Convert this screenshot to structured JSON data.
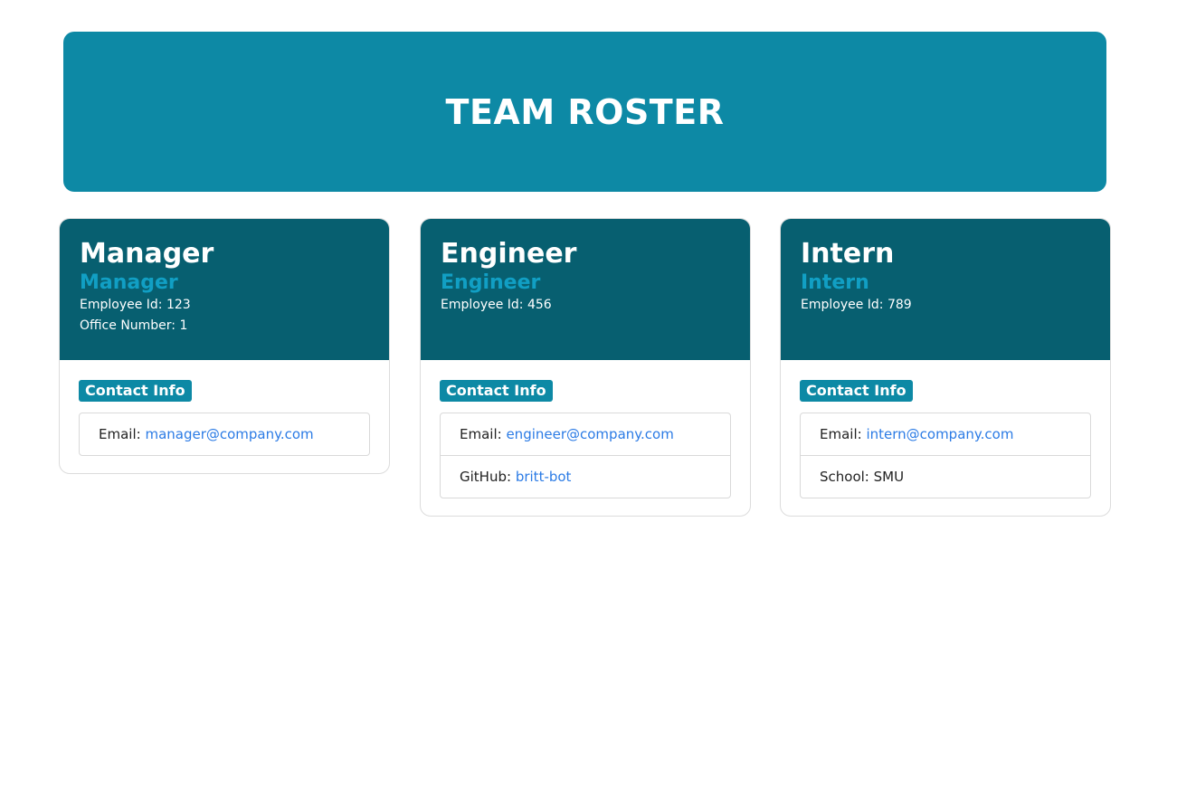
{
  "header": {
    "title": "TEAM ROSTER"
  },
  "colors": {
    "banner": "#0d89a5",
    "card_header": "#075f70",
    "role": "#119fc4",
    "link": "#2b7be5"
  },
  "cards": [
    {
      "name": "Manager",
      "role": "Manager",
      "employee_id": "Employee Id: 123",
      "extra_line": "Office Number: 1",
      "badge": "Contact Info",
      "email_label": "Email:",
      "email": "manager@company.com"
    },
    {
      "name": "Engineer",
      "role": "Engineer",
      "employee_id": "Employee Id: 456",
      "badge": "Contact Info",
      "email_label": "Email:",
      "email": "engineer@company.com",
      "second_label": "GitHub:",
      "second_value": "britt-bot"
    },
    {
      "name": "Intern",
      "role": "Intern",
      "employee_id": "Employee Id: 789",
      "badge": "Contact Info",
      "email_label": "Email:",
      "email": "intern@company.com",
      "second_label": "School:",
      "second_value": "SMU"
    }
  ]
}
